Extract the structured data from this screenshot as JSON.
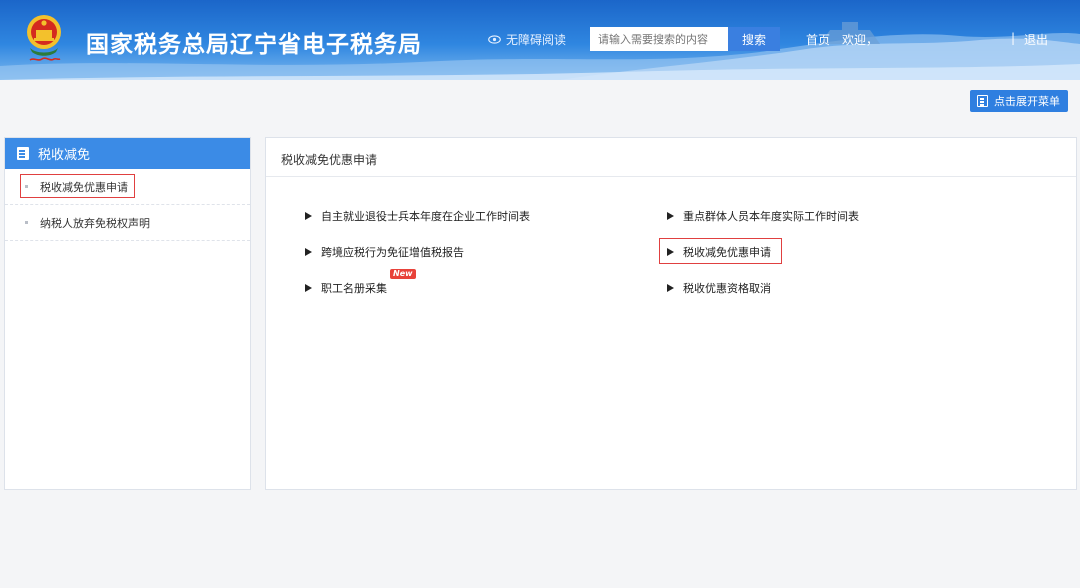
{
  "header": {
    "site_title": "国家税务总局辽宁省电子税务局",
    "accessibility_label": "无障碍阅读",
    "search_placeholder": "请输入需要搜索的内容",
    "search_button": "搜索",
    "home_link": "首页",
    "welcome_text": "欢迎，",
    "separator": "|",
    "logout": "退出"
  },
  "toolbar": {
    "expand_menu_label": "点击展开菜单"
  },
  "sidebar": {
    "title": "税收减免",
    "items": [
      {
        "label": "税收减免优惠申请"
      },
      {
        "label": "纳税人放弃免税权声明"
      }
    ]
  },
  "main": {
    "title": "税收减免优惠申请",
    "new_badge": "New",
    "links": [
      {
        "label": "自主就业退役士兵本年度在企业工作时间表"
      },
      {
        "label": "重点群体人员本年度实际工作时间表"
      },
      {
        "label": "跨境应税行为免征增值税报告"
      },
      {
        "label": "税收减免优惠申请"
      },
      {
        "label": "职工名册采集"
      },
      {
        "label": "税收优惠资格取消"
      }
    ]
  },
  "colors": {
    "header_blue": "#1b66c9",
    "sidebar_header": "#3b8be6",
    "highlight_red": "#e04040",
    "new_badge_red": "#e8423a"
  },
  "icons": [
    "national-emblem-icon",
    "eye-icon",
    "menu-list-icon",
    "document-icon",
    "triangle-right-icon"
  ]
}
